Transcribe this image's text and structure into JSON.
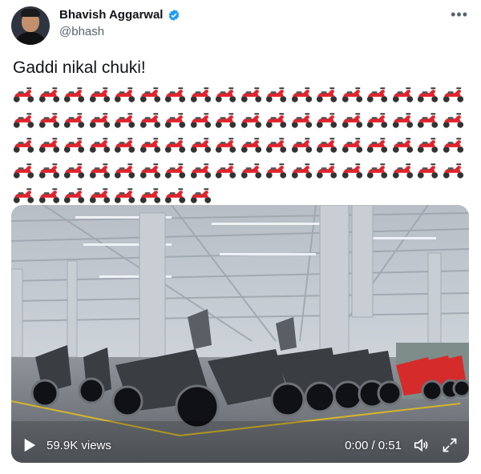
{
  "author": {
    "name": "Bhavish Aggarwal",
    "handle": "@bhash"
  },
  "icons": {
    "verified": "verified-badge-icon",
    "more": "more-options-icon",
    "emoji": "motor-scooter-emoji",
    "play": "play-icon",
    "volume": "volume-icon",
    "fullscreen": "fullscreen-icon"
  },
  "tweet": {
    "text": "Gaddi nikal chuki!",
    "emoji_rows": [
      18,
      18,
      18,
      18,
      8
    ]
  },
  "video": {
    "views": "59.9K views",
    "time": "0:00 / 0:51"
  },
  "colors": {
    "verified": "#1d9bf0",
    "scooter_red": "#e0242d"
  }
}
